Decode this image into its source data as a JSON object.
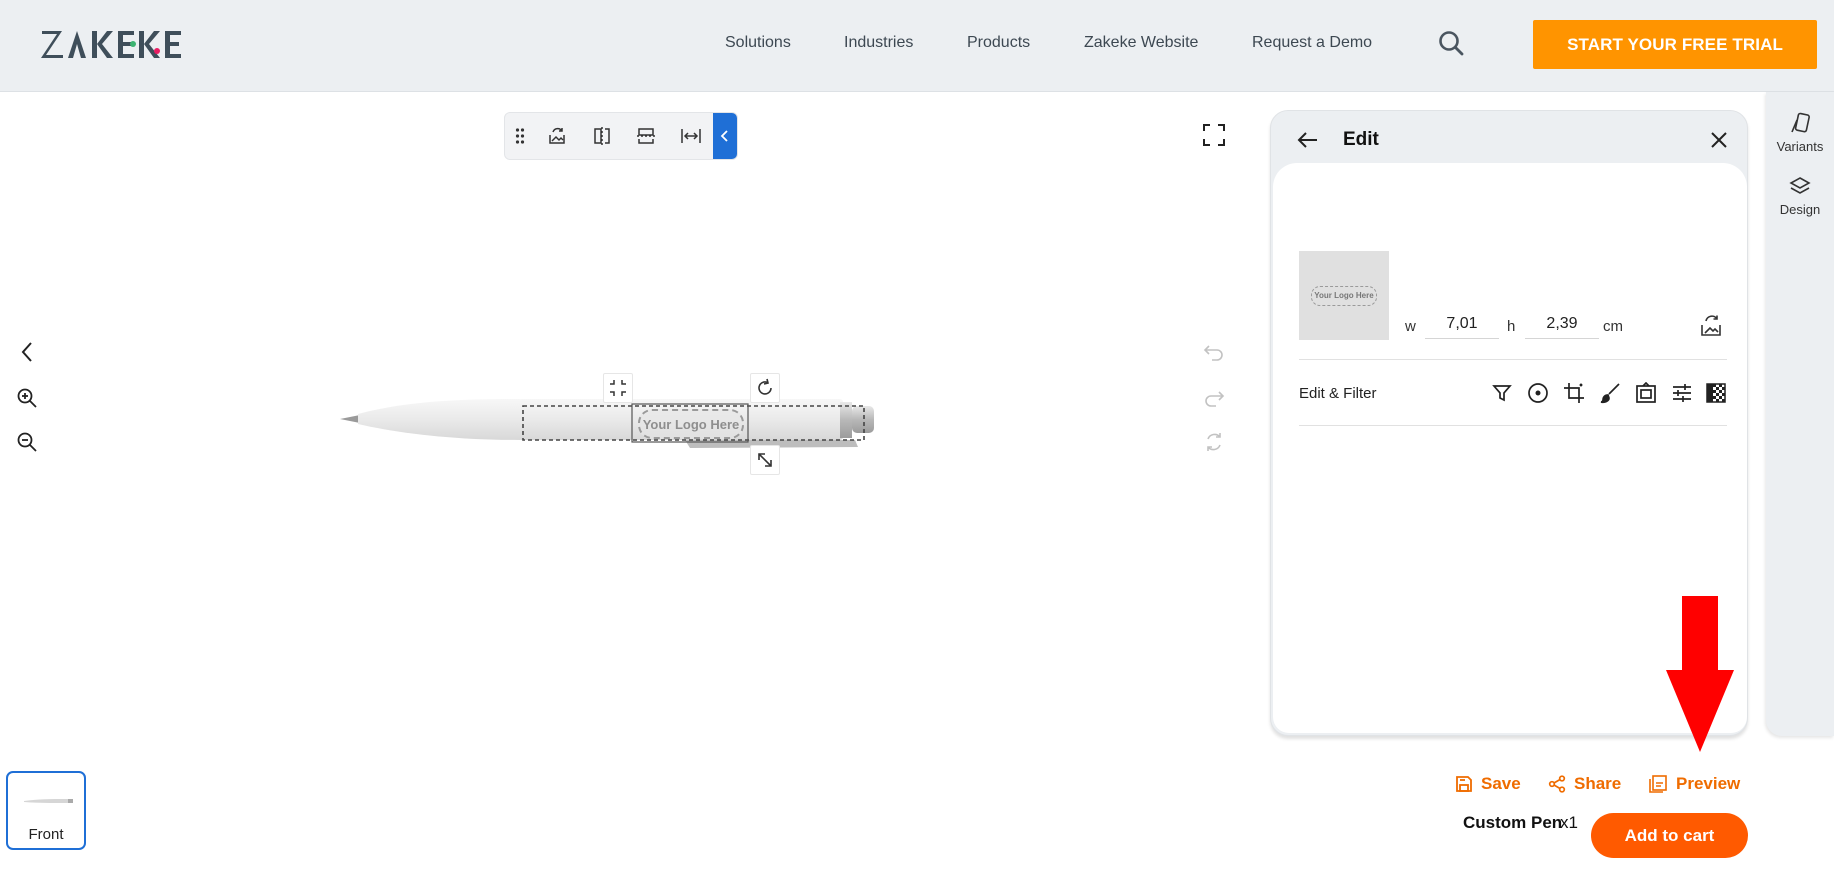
{
  "header": {
    "logo_text": "ZAKEKE",
    "nav": [
      "Solutions",
      "Industries",
      "Products",
      "Zakeke Website",
      "Request a Demo"
    ],
    "cta_label": "START YOUR FREE TRIAL"
  },
  "toolbar": {
    "tools": [
      "drag-handle-icon",
      "replace-image-icon",
      "center-vertical-icon",
      "center-horizontal-icon",
      "stretch-width-icon",
      "collapse-icon"
    ]
  },
  "canvas": {
    "logo_placeholder": "Your Logo Here"
  },
  "edit_panel": {
    "title": "Edit",
    "thumb_text": "Your Logo Here",
    "w_label": "w",
    "w_value": "7,01",
    "h_label": "h",
    "h_value": "2,39",
    "unit": "cm",
    "edit_filter_label": "Edit & Filter",
    "filter_tools": [
      "filter-icon",
      "circle-crop-icon",
      "crop-icon",
      "brush-icon",
      "frame-icon",
      "adjust-icon",
      "transparency-icon"
    ]
  },
  "rail": {
    "items": [
      {
        "label": "Variants",
        "icon": "variants-icon"
      },
      {
        "label": "Design",
        "icon": "layers-icon"
      }
    ]
  },
  "bottom": {
    "side_label": "Front",
    "save_label": "Save",
    "share_label": "Share",
    "preview_label": "Preview",
    "product_name": "Custom Pen",
    "quantity": "x1",
    "add_to_cart_label": "Add to cart"
  },
  "colors": {
    "cta": "#ff9400",
    "accent_blue": "#1f6fd6",
    "action_orange": "#ef6c00",
    "add_to_cart": "#ff5a00",
    "annotation_arrow": "#ff0000"
  }
}
